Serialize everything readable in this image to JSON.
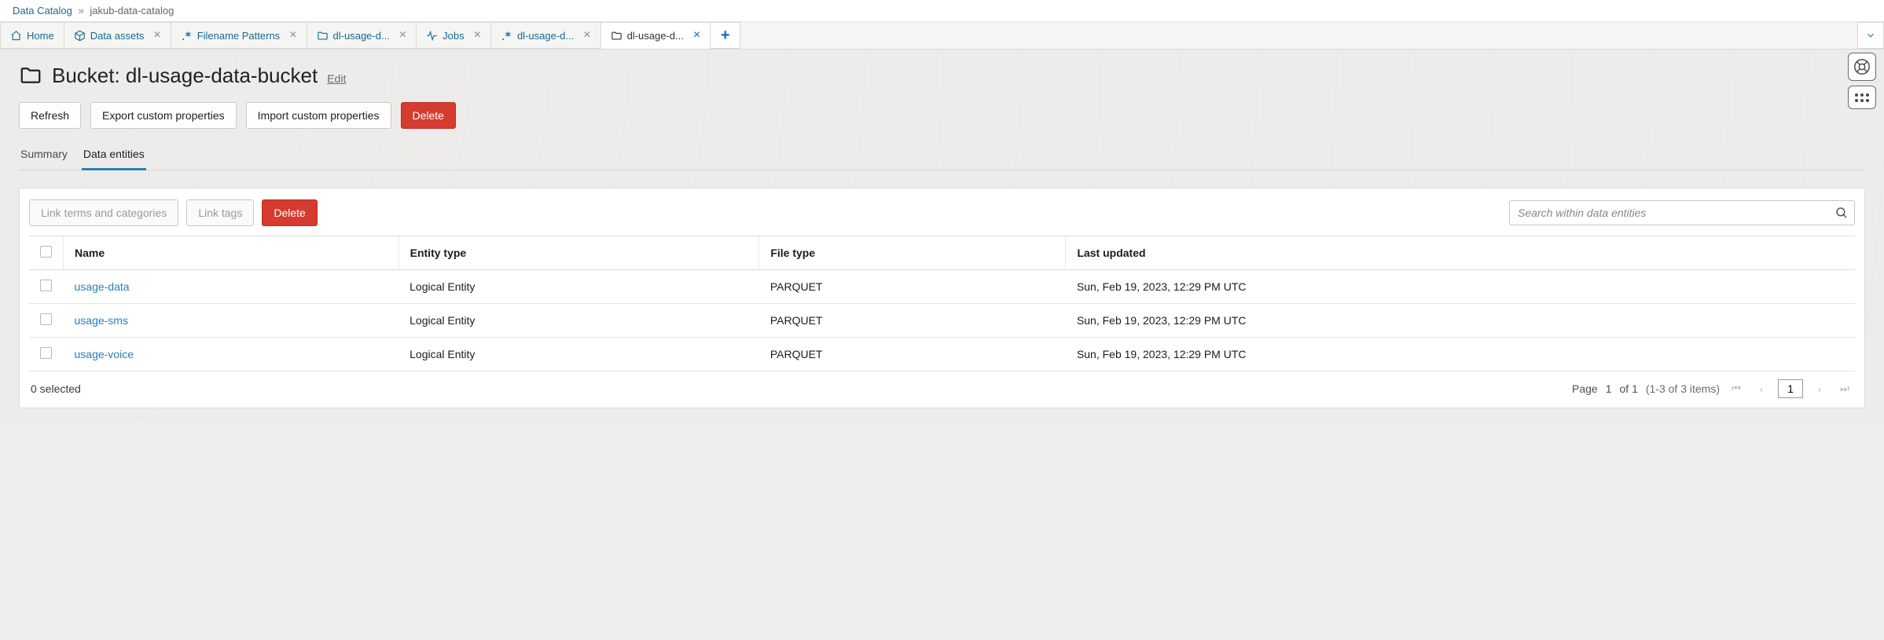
{
  "breadcrumb": {
    "root": "Data Catalog",
    "sep": "»",
    "current": "jakub-data-catalog"
  },
  "tabs": [
    {
      "label": "Home",
      "icon": "home",
      "closable": false,
      "active": false
    },
    {
      "label": "Data assets",
      "icon": "cube",
      "closable": true,
      "active": false
    },
    {
      "label": "Filename Patterns",
      "icon": "regex",
      "closable": true,
      "active": false
    },
    {
      "label": "dl-usage-d...",
      "icon": "folder",
      "closable": true,
      "active": false
    },
    {
      "label": "Jobs",
      "icon": "pulse",
      "closable": true,
      "active": false
    },
    {
      "label": "dl-usage-d...",
      "icon": "regex",
      "closable": true,
      "active": false
    },
    {
      "label": "dl-usage-d...",
      "icon": "folder",
      "closable": true,
      "active": true
    }
  ],
  "tab_add": "+",
  "title": "Bucket: dl-usage-data-bucket",
  "edit_label": "Edit",
  "actions": {
    "refresh": "Refresh",
    "export": "Export custom properties",
    "import": "Import custom properties",
    "delete": "Delete"
  },
  "inner_tabs": {
    "summary": "Summary",
    "entities": "Data entities"
  },
  "toolbar": {
    "link_terms": "Link terms and categories",
    "link_tags": "Link tags",
    "delete": "Delete"
  },
  "search": {
    "placeholder": "Search within data entities"
  },
  "table": {
    "headers": {
      "name": "Name",
      "entity_type": "Entity type",
      "file_type": "File type",
      "last_updated": "Last updated"
    },
    "rows": [
      {
        "name": "usage-data",
        "entity_type": "Logical Entity",
        "file_type": "PARQUET",
        "last_updated": "Sun, Feb 19, 2023, 12:29 PM UTC"
      },
      {
        "name": "usage-sms",
        "entity_type": "Logical Entity",
        "file_type": "PARQUET",
        "last_updated": "Sun, Feb 19, 2023, 12:29 PM UTC"
      },
      {
        "name": "usage-voice",
        "entity_type": "Logical Entity",
        "file_type": "PARQUET",
        "last_updated": "Sun, Feb 19, 2023, 12:29 PM UTC"
      }
    ]
  },
  "footer": {
    "selected": "0 selected",
    "page_label": "Page",
    "page": "1",
    "of_label": "of 1",
    "range": "(1-3 of 3 items)",
    "input": "1"
  }
}
